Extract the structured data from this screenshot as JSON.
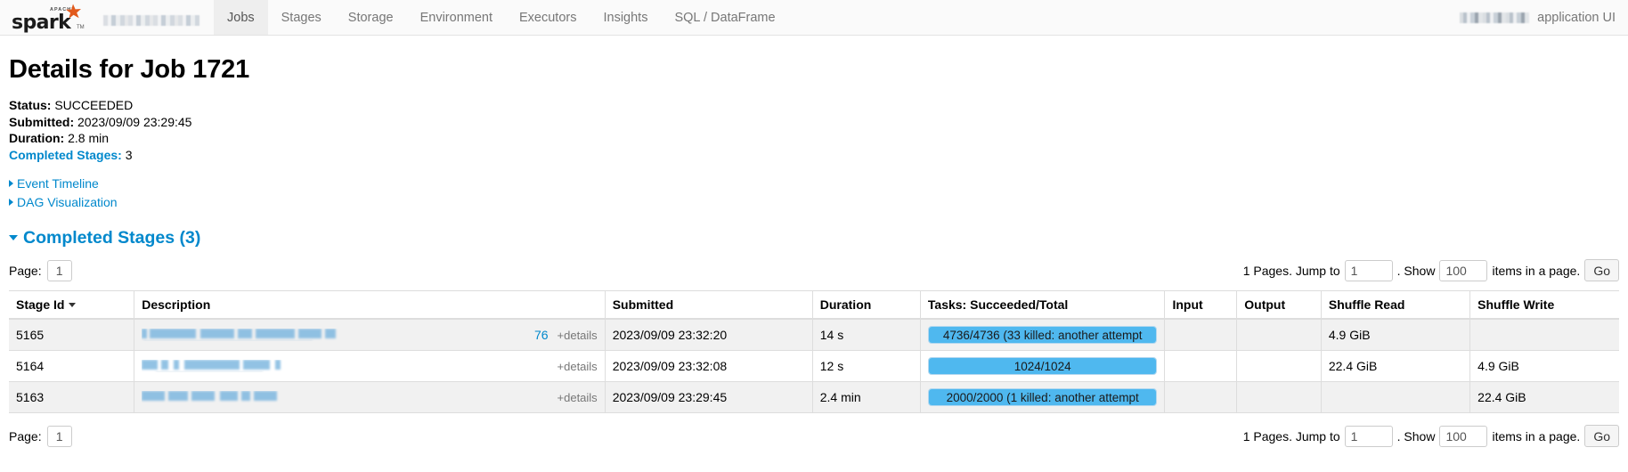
{
  "navbar": {
    "logo_alt": "Apache Spark",
    "logo_text_top": "APACHE",
    "logo_text_main": "spark",
    "app_name_redacted": "",
    "items": [
      {
        "label": "Jobs",
        "active": true
      },
      {
        "label": "Stages",
        "active": false
      },
      {
        "label": "Storage",
        "active": false
      },
      {
        "label": "Environment",
        "active": false
      },
      {
        "label": "Executors",
        "active": false
      },
      {
        "label": "Insights",
        "active": false
      },
      {
        "label": "SQL / DataFrame",
        "active": false
      }
    ],
    "right_label": "application UI",
    "right_version_redacted": ""
  },
  "page": {
    "title": "Details for Job 1721",
    "status_label": "Status:",
    "status_value": "SUCCEEDED",
    "submitted_label": "Submitted:",
    "submitted_value": "2023/09/09 23:29:45",
    "duration_label": "Duration:",
    "duration_value": "2.8 min",
    "completed_stages_label": "Completed Stages:",
    "completed_stages_value": "3",
    "event_timeline": "Event Timeline",
    "dag_visualization": "DAG Visualization",
    "section_title": "Completed Stages",
    "section_count": "(3)"
  },
  "pager": {
    "page_label": "Page:",
    "page_value": "1",
    "pages_text": "1 Pages. Jump to",
    "jump_value": "1",
    "dot_show": ". Show",
    "show_value": "100",
    "items_text": "items in a page.",
    "go_label": "Go"
  },
  "table": {
    "columns": [
      {
        "key": "stage_id",
        "label": "Stage Id",
        "sorted": true
      },
      {
        "key": "description",
        "label": "Description",
        "sorted": false
      },
      {
        "key": "submitted",
        "label": "Submitted",
        "sorted": false
      },
      {
        "key": "duration",
        "label": "Duration",
        "sorted": false
      },
      {
        "key": "tasks",
        "label": "Tasks: Succeeded/Total",
        "sorted": false
      },
      {
        "key": "input",
        "label": "Input",
        "sorted": false
      },
      {
        "key": "output",
        "label": "Output",
        "sorted": false
      },
      {
        "key": "shuffle_read",
        "label": "Shuffle Read",
        "sorted": false
      },
      {
        "key": "shuffle_write",
        "label": "Shuffle Write",
        "sorted": false
      }
    ],
    "details_label": "+details",
    "rows": [
      {
        "stage_id": "5165",
        "description_redacted": "",
        "description_suffix": "76",
        "submitted": "2023/09/09 23:32:20",
        "duration": "14 s",
        "tasks_text": "4736/4736 (33 killed: another attempt",
        "tasks_percent": 100,
        "input": "",
        "output": "",
        "shuffle_read": "4.9 GiB",
        "shuffle_write": ""
      },
      {
        "stage_id": "5164",
        "description_redacted": "",
        "description_suffix": "",
        "submitted": "2023/09/09 23:32:08",
        "duration": "12 s",
        "tasks_text": "1024/1024",
        "tasks_percent": 100,
        "input": "",
        "output": "",
        "shuffle_read": "22.4 GiB",
        "shuffle_write": "4.9 GiB"
      },
      {
        "stage_id": "5163",
        "description_redacted": "",
        "description_suffix": "",
        "submitted": "2023/09/09 23:29:45",
        "duration": "2.4 min",
        "tasks_text": "2000/2000 (1 killed: another attempt",
        "tasks_percent": 100,
        "input": "",
        "output": "",
        "shuffle_read": "",
        "shuffle_write": "22.4 GiB"
      }
    ]
  },
  "colors": {
    "link": "#0088cc",
    "progress_fill": "#4fb8ef",
    "progress_border": "#b4d8ef",
    "nav_active_bg": "#eeeeee",
    "row_alt_bg": "#f1f1f1"
  }
}
